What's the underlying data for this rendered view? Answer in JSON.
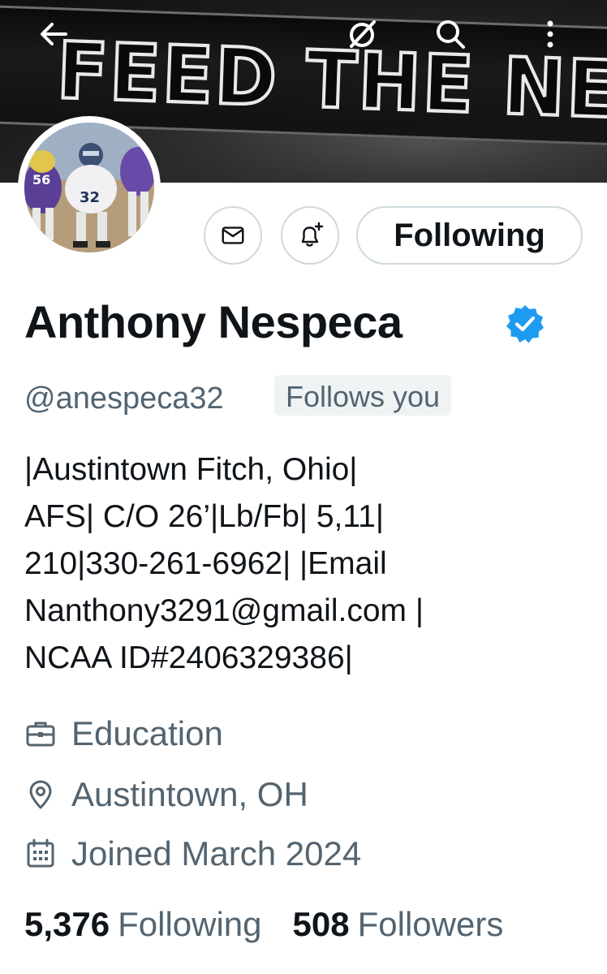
{
  "banner": {
    "text": "FEED THE NEST"
  },
  "top_bar": {
    "back_icon": "arrow-left-icon",
    "grok_icon": "grok-slash-circle-icon",
    "search_icon": "search-icon",
    "more_icon": "more-vertical-icon"
  },
  "profile": {
    "avatar_jersey": "32",
    "avatar_jersey_2": "56",
    "name": "Anthony Nespeca",
    "verified": true,
    "handle": "@anespeca32",
    "follows_you_label": "Follows you",
    "bio_lines": [
      "|Austintown Fitch, Ohio|",
      "AFS| C/O 26’|Lb/Fb| 5,11|",
      "210|330-261-6962| |Email",
      "Nanthony3291@gmail.com |",
      "NCAA ID#2406329386|"
    ],
    "category": "Education",
    "location": "Austintown, OH",
    "joined": "Joined March 2024"
  },
  "actions": {
    "following_label": "Following",
    "message_icon": "envelope-icon",
    "notify_icon": "bell-plus-icon"
  },
  "stats": {
    "following_count": "5,376",
    "following_label": "Following",
    "followers_count": "508",
    "followers_label": "Followers"
  },
  "colors": {
    "primary_text": "#0f1419",
    "secondary_text": "#536471",
    "verified_blue": "#1d9bf0",
    "border": "#cfd9de",
    "pill_bg": "#eff3f4"
  }
}
